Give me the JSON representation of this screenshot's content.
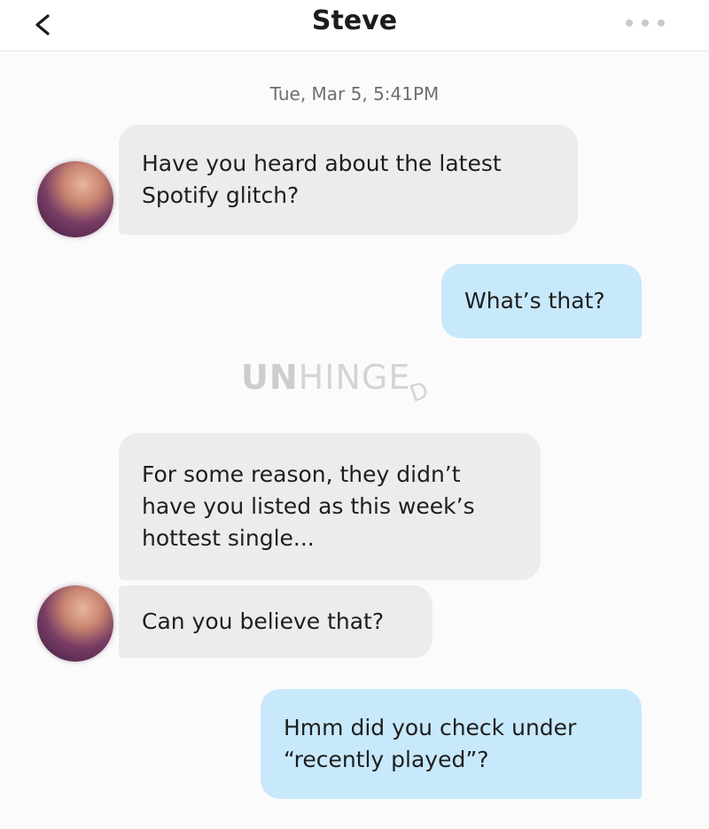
{
  "header": {
    "title": "Steve",
    "back_icon": "chevron-left-icon",
    "more_icon": "more-dots-icon"
  },
  "conversation": {
    "timestamp": "Tue, Mar 5, 5:41PM",
    "messages": [
      {
        "sender": "incoming",
        "lines": [
          "Have you heard about the latest",
          "Spotify glitch?"
        ]
      },
      {
        "sender": "outgoing",
        "lines": [
          "What’s that?"
        ]
      },
      {
        "sender": "incoming",
        "lines": [
          "For some reason, they didn’t",
          "have you listed as this week’s",
          "hottest single..."
        ]
      },
      {
        "sender": "incoming",
        "lines": [
          "Can you believe that?"
        ]
      },
      {
        "sender": "outgoing",
        "lines": [
          "Hmm did you check under",
          "“recently played”?"
        ]
      }
    ]
  },
  "watermark": {
    "bold": "UN",
    "light": "HINGE",
    "suffix": "D"
  },
  "colors": {
    "incoming_bubble": "#ececec",
    "outgoing_bubble": "#c8e9fb",
    "background": "#fbfbfb"
  }
}
